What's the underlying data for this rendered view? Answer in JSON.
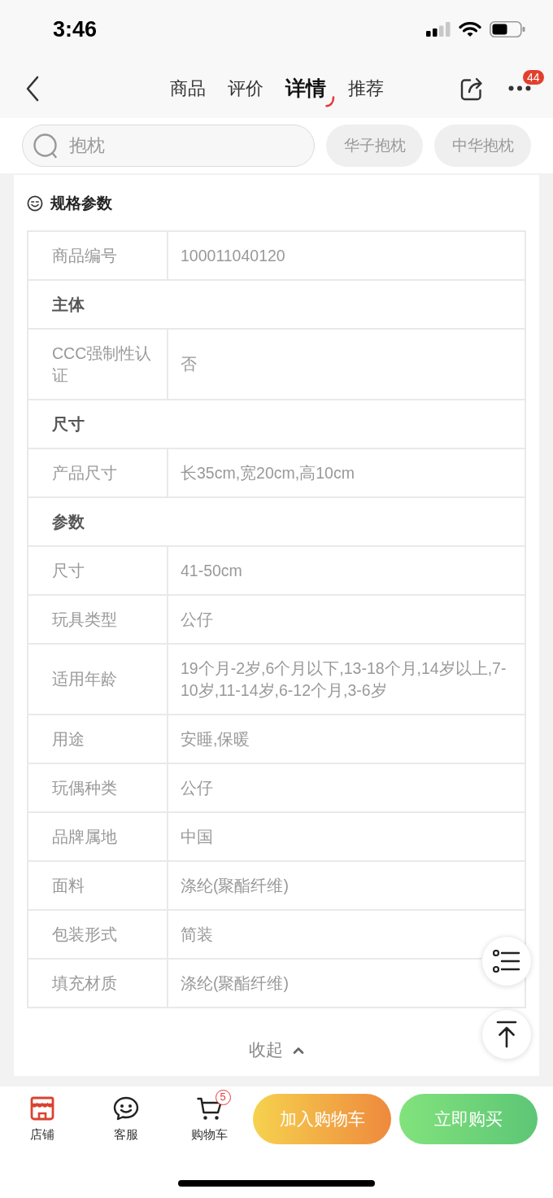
{
  "status_bar": {
    "time": "3:46"
  },
  "nav": {
    "tabs": [
      {
        "label": "商品",
        "selected": false
      },
      {
        "label": "评价",
        "selected": false
      },
      {
        "label": "详情",
        "selected": true
      },
      {
        "label": "推荐",
        "selected": false
      }
    ],
    "more_badge": "44"
  },
  "search": {
    "placeholder": "抱枕",
    "suggestions": [
      "华子抱枕",
      "中华抱枕"
    ]
  },
  "specs": {
    "title": "规格参数",
    "rows": [
      {
        "kind": "pair",
        "label": "商品编号",
        "value": "100011040120"
      },
      {
        "kind": "group",
        "title": "主体"
      },
      {
        "kind": "pair",
        "label": "CCC强制性认证",
        "value": "否"
      },
      {
        "kind": "group",
        "title": "尺寸"
      },
      {
        "kind": "pair",
        "label": "产品尺寸",
        "value": "长35cm,宽20cm,高10cm"
      },
      {
        "kind": "group",
        "title": "参数"
      },
      {
        "kind": "pair",
        "label": "尺寸",
        "value": "41-50cm"
      },
      {
        "kind": "pair",
        "label": "玩具类型",
        "value": "公仔"
      },
      {
        "kind": "pair",
        "label": "适用年龄",
        "value": "19个月-2岁,6个月以下,13-18个月,14岁以上,7-10岁,11-14岁,6-12个月,3-6岁"
      },
      {
        "kind": "pair",
        "label": "用途",
        "value": "安睡,保暖"
      },
      {
        "kind": "pair",
        "label": "玩偶种类",
        "value": "公仔"
      },
      {
        "kind": "pair",
        "label": "品牌属地",
        "value": "中国"
      },
      {
        "kind": "pair",
        "label": "面料",
        "value": "涤纶(聚酯纤维)"
      },
      {
        "kind": "pair",
        "label": "包装形式",
        "value": "简装"
      },
      {
        "kind": "pair",
        "label": "填充材质",
        "value": "涤纶(聚酯纤维)"
      }
    ],
    "collapse": "收起"
  },
  "bottom_bar": {
    "actions": [
      {
        "kind": "store",
        "label": "店铺"
      },
      {
        "kind": "service",
        "label": "客服"
      },
      {
        "kind": "cart",
        "label": "购物车",
        "badge": "5"
      }
    ],
    "buttons": [
      {
        "kind": "cart",
        "label": "加入购物车"
      },
      {
        "kind": "buy",
        "label": "立即购买"
      }
    ]
  }
}
